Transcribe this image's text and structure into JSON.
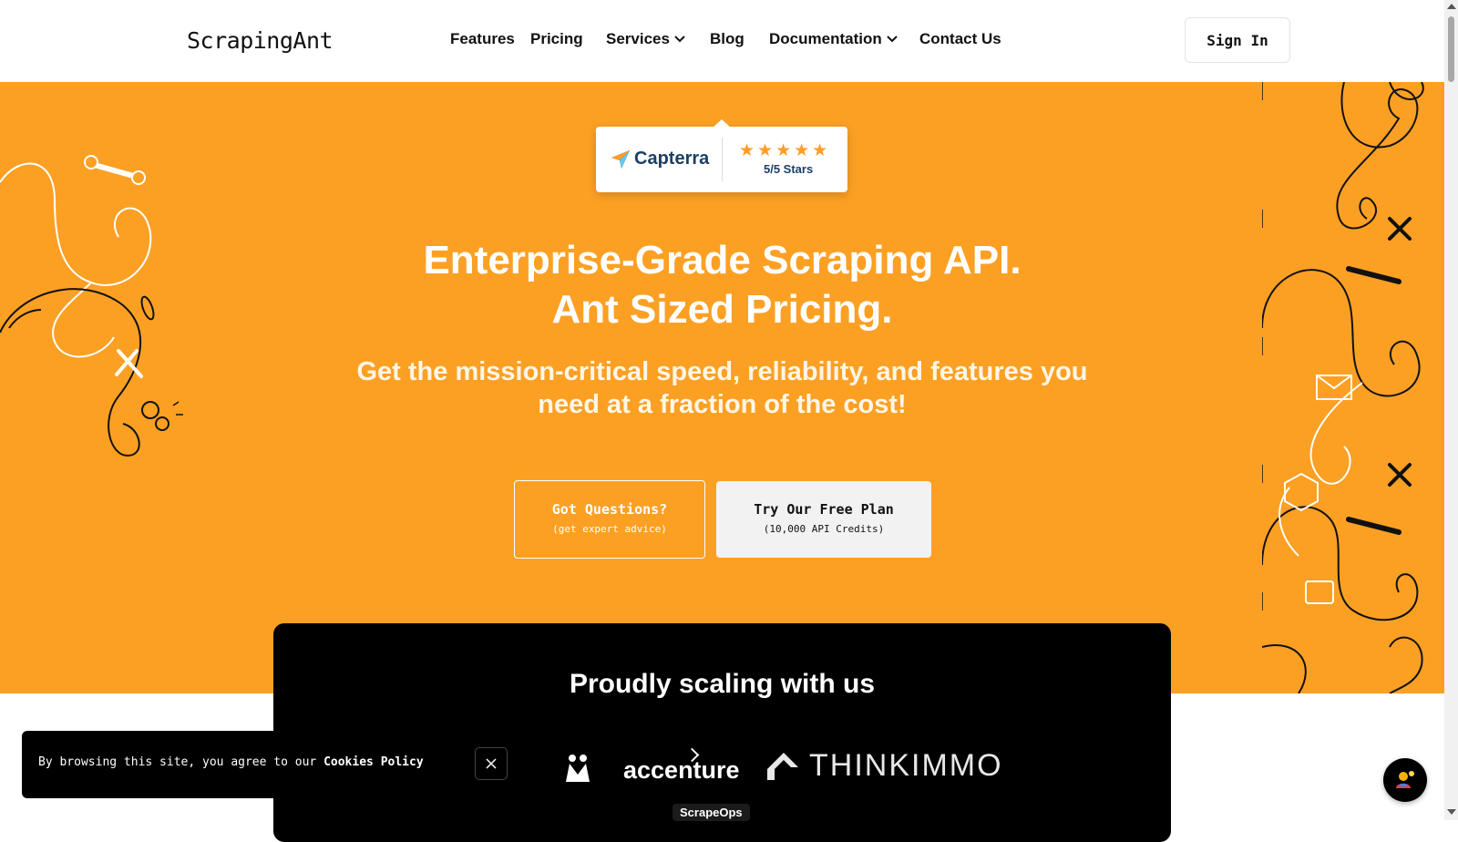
{
  "brand": {
    "name": "ScrapingAnt"
  },
  "nav": {
    "items": [
      {
        "label": "Features"
      },
      {
        "label": "Pricing"
      },
      {
        "label": "Services"
      },
      {
        "label": "Blog"
      },
      {
        "label": "Documentation"
      },
      {
        "label": "Contact Us"
      }
    ],
    "sign_in": "Sign In"
  },
  "hero": {
    "badge": {
      "brand": "Capterra",
      "stars": "★★★★★",
      "rating": "5/5 Stars"
    },
    "title_line1": "Enterprise-Grade Scraping API.",
    "title_line2": "Ant Sized Pricing.",
    "subtitle": "Get the mission-critical speed, reliability, and features you need at a fraction of the cost!",
    "questions_button": {
      "label": "Got Questions?",
      "sub": "(get expert advice)"
    },
    "free_button": {
      "label": "Try Our Free Plan",
      "sub": "(10,000 API Credits)"
    }
  },
  "clients": {
    "title": "Proudly scaling with us",
    "logos": [
      "accenture",
      "THINKIMMO",
      "ScrapeOps"
    ]
  },
  "cookie": {
    "text": "By browsing this site, you agree to our ",
    "link": "Cookies Policy"
  },
  "colors": {
    "hero_bg": "#fca024",
    "dark": "#000000",
    "white": "#ffffff"
  }
}
